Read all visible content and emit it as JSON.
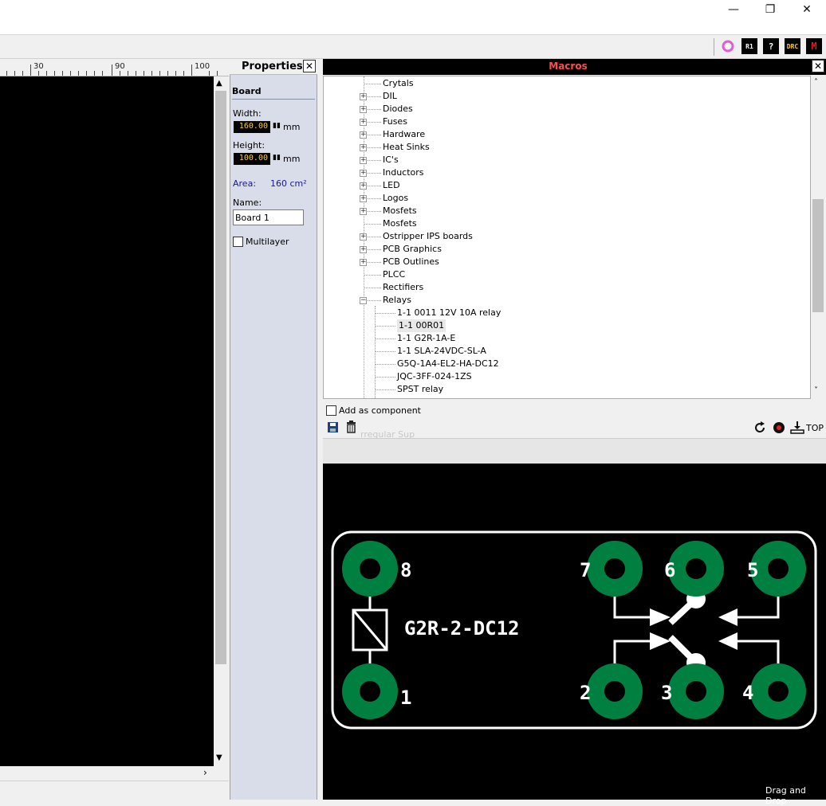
{
  "window": {
    "minimize": "—",
    "restore": "❐",
    "close": "✕"
  },
  "toolbar": {
    "icons": [
      {
        "name": "ring-icon",
        "label": ""
      },
      {
        "name": "r1-icon",
        "label": "R1"
      },
      {
        "name": "help-icon",
        "label": "?"
      },
      {
        "name": "drc-icon",
        "label": "DRC"
      },
      {
        "name": "macro-icon",
        "label": "M"
      }
    ]
  },
  "ruler": {
    "labels": [
      "30",
      "90",
      "100"
    ]
  },
  "properties": {
    "title": "Properties",
    "section": "Board",
    "width_label": "Width:",
    "width_value": "160.00",
    "width_unit": "mm",
    "height_label": "Height:",
    "height_value": "100.00",
    "height_unit": "mm",
    "area_label": "Area:",
    "area_value": "160 cm²",
    "name_label": "Name:",
    "name_value": "Board 1",
    "multilayer_label": "Multilayer"
  },
  "macros": {
    "title": "Macros",
    "tree": [
      {
        "label": "Crytals",
        "expander": "none",
        "level": 1
      },
      {
        "label": "DIL",
        "expander": "plus",
        "level": 1
      },
      {
        "label": "Diodes",
        "expander": "plus",
        "level": 1
      },
      {
        "label": "Fuses",
        "expander": "plus",
        "level": 1
      },
      {
        "label": "Hardware",
        "expander": "plus",
        "level": 1
      },
      {
        "label": "Heat Sinks",
        "expander": "plus",
        "level": 1
      },
      {
        "label": "IC's",
        "expander": "plus",
        "level": 1
      },
      {
        "label": "Inductors",
        "expander": "plus",
        "level": 1
      },
      {
        "label": "LED",
        "expander": "plus",
        "level": 1
      },
      {
        "label": "Logos",
        "expander": "plus",
        "level": 1
      },
      {
        "label": "Mosfets",
        "expander": "plus",
        "level": 1
      },
      {
        "label": "Mosfets",
        "expander": "none",
        "level": 1
      },
      {
        "label": "Ostripper IPS boards",
        "expander": "plus",
        "level": 1
      },
      {
        "label": "PCB Graphics",
        "expander": "plus",
        "level": 1
      },
      {
        "label": "PCB Outlines",
        "expander": "plus",
        "level": 1
      },
      {
        "label": "PLCC",
        "expander": "none",
        "level": 1
      },
      {
        "label": "Rectifiers",
        "expander": "none",
        "level": 1
      },
      {
        "label": "Relays",
        "expander": "minus",
        "level": 1
      },
      {
        "label": "1-1  0011 12V 10A relay",
        "expander": "none",
        "level": 2
      },
      {
        "label": "1-1 00R01",
        "expander": "none",
        "level": 2,
        "selected": true
      },
      {
        "label": "1-1 G2R-1A-E",
        "expander": "none",
        "level": 2
      },
      {
        "label": "1-1 SLA-24VDC-SL-A",
        "expander": "none",
        "level": 2
      },
      {
        "label": "G5Q-1A4-EL2-HA-DC12",
        "expander": "none",
        "level": 2
      },
      {
        "label": "JQC-3FF-024-1ZS",
        "expander": "none",
        "level": 2
      },
      {
        "label": "SPST relay",
        "expander": "none",
        "level": 2
      }
    ],
    "add_as_component": "Add as component",
    "top_label": "TOP",
    "ghost_text": "rregular Sup",
    "drag_drop": "Drag and Drop"
  },
  "footprint": {
    "part_label": "G2R-2-DC12",
    "pins": [
      {
        "n": "8"
      },
      {
        "n": "1"
      },
      {
        "n": "7"
      },
      {
        "n": "6"
      },
      {
        "n": "5"
      },
      {
        "n": "2"
      },
      {
        "n": "3"
      },
      {
        "n": "4"
      }
    ],
    "colors": {
      "pad": "#008040",
      "silk": "#ffffff",
      "background": "#000000"
    }
  },
  "colors": {
    "macros_title": "#ff4d4d",
    "area": "#1a1a8c"
  }
}
